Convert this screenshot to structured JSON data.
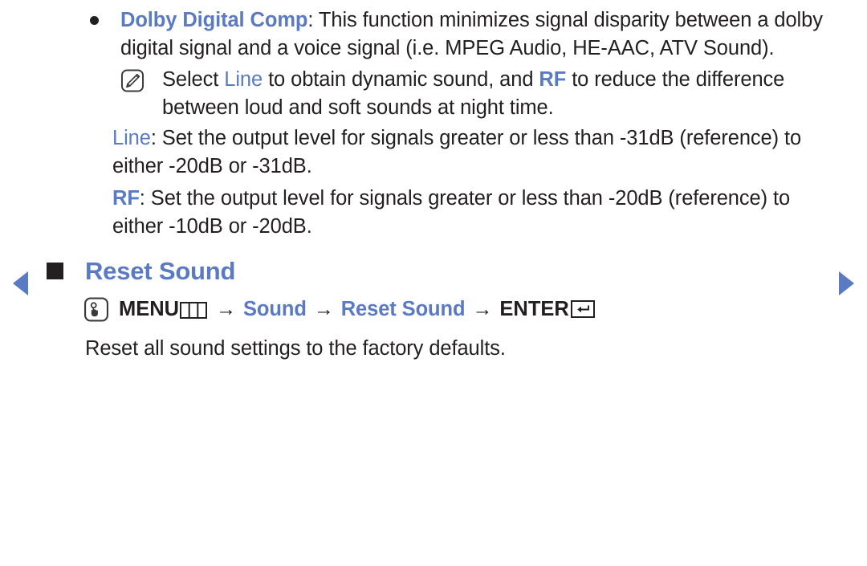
{
  "colors": {
    "accent_blue": "#5b7ac4",
    "text": "#231f20",
    "background": "#ffffff"
  },
  "nav": {
    "prev_label": "Previous page",
    "next_label": "Next page"
  },
  "bullet": {
    "term": "Dolby Digital Comp",
    "separator": ": ",
    "body": "This function minimizes signal disparity between a dolby digital signal and a voice signal (i.e. MPEG Audio, HE-AAC, ATV Sound)."
  },
  "note": {
    "icon_name": "note-pen-icon",
    "text_1": "Select ",
    "highlight_1": "Line",
    "text_2": " to obtain dynamic sound, and ",
    "highlight_2": "RF",
    "text_3": " to reduce the difference between loud and soft sounds at night time."
  },
  "paragraphs": [
    {
      "term": "Line",
      "separator": ": ",
      "body": "Set the output level for signals greater or less than -31dB (reference) to either -20dB or -31dB."
    },
    {
      "term": "RF",
      "separator": ": ",
      "body": "Set the output level for signals greater or less than -20dB (reference) to either -10dB or -20dB."
    }
  ],
  "section": {
    "marker_name": "section-square-marker",
    "title": "Reset Sound"
  },
  "menu_path": {
    "press_icon_name": "press-hand-icon",
    "menu_label": "MENU",
    "menu_glyph_name": "menu-button-icon",
    "arrow": "→",
    "step_2": "Sound",
    "step_3": "Reset Sound",
    "enter_label": "ENTER",
    "enter_glyph_name": "enter-return-icon"
  },
  "description": "Reset all sound settings to the factory defaults."
}
